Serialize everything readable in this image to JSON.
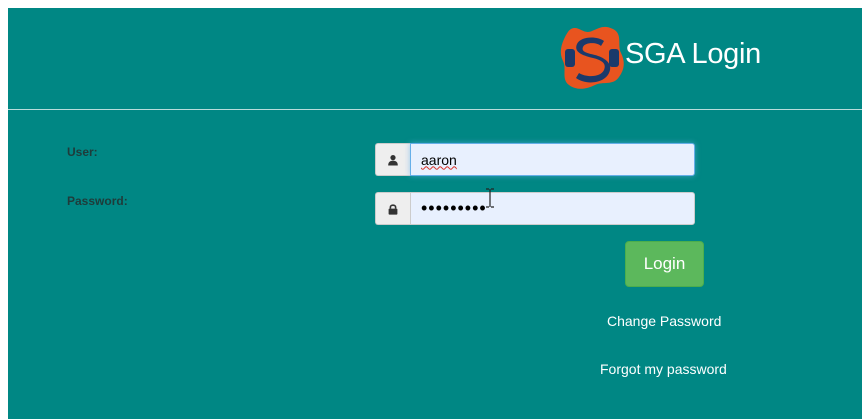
{
  "header": {
    "title": "SGA Login",
    "logo_colors": {
      "blue": "#1b3a6b",
      "orange": "#e8541f"
    }
  },
  "form": {
    "user_label": "User:",
    "user_value": "aaron",
    "user_icon": "user-icon",
    "password_label": "Password:",
    "password_value": "•••••••••",
    "password_icon": "lock-icon",
    "login_label": "Login"
  },
  "links": {
    "change_password": "Change Password",
    "forgot_password": "Forgot my password"
  },
  "colors": {
    "background": "#008784",
    "button": "#5cb85c",
    "input_fill": "#e8f0fe"
  }
}
